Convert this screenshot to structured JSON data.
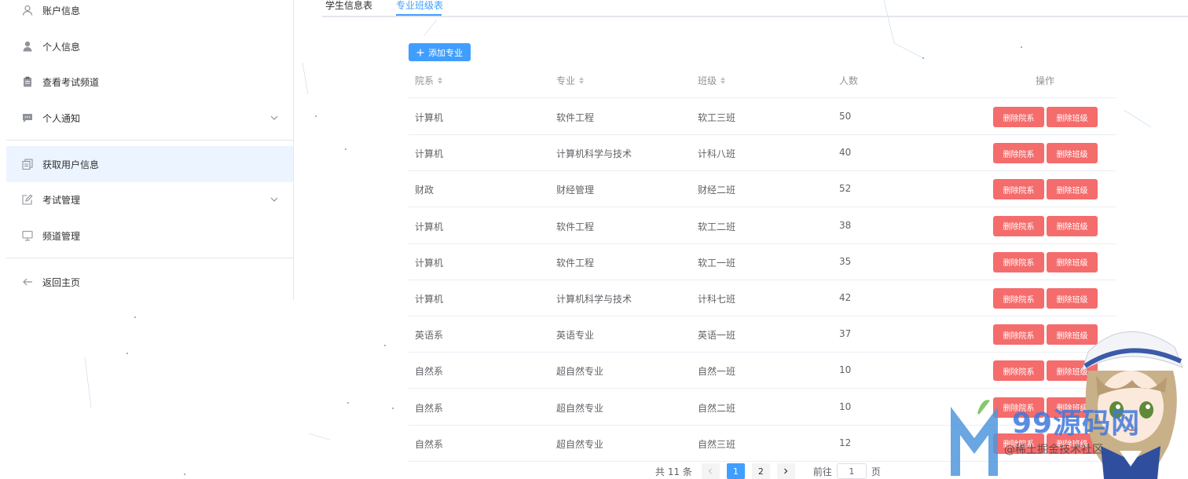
{
  "sidebar": {
    "items": [
      {
        "label": "账户信息",
        "icon": "user-outline-icon"
      },
      {
        "label": "个人信息",
        "icon": "user-solid-icon"
      },
      {
        "label": "查看考试频道",
        "icon": "clipboard-icon"
      },
      {
        "label": "个人通知",
        "icon": "chat-icon",
        "expandable": true
      },
      {
        "label": "获取用户信息",
        "icon": "document-copy-icon",
        "active": true
      },
      {
        "label": "考试管理",
        "icon": "edit-icon",
        "expandable": true
      },
      {
        "label": "频道管理",
        "icon": "monitor-icon"
      },
      {
        "label": "返回主页",
        "icon": "back-arrow-icon"
      }
    ]
  },
  "tabs": [
    {
      "label": "学生信息表",
      "active": false
    },
    {
      "label": "专业班级表",
      "active": true
    }
  ],
  "toolbar": {
    "add_label": "添加专业"
  },
  "table": {
    "columns": [
      "院系",
      "专业",
      "班级",
      "人数",
      "操作"
    ],
    "rows": [
      {
        "dept": "计算机",
        "major": "软件工程",
        "class": "软工三班",
        "count": "50"
      },
      {
        "dept": "计算机",
        "major": "计算机科学与技术",
        "class": "计科八班",
        "count": "40"
      },
      {
        "dept": "财政",
        "major": "财经管理",
        "class": "财经二班",
        "count": "52"
      },
      {
        "dept": "计算机",
        "major": "软件工程",
        "class": "软工二班",
        "count": "38"
      },
      {
        "dept": "计算机",
        "major": "软件工程",
        "class": "软工一班",
        "count": "35"
      },
      {
        "dept": "计算机",
        "major": "计算机科学与技术",
        "class": "计科七班",
        "count": "42"
      },
      {
        "dept": "英语系",
        "major": "英语专业",
        "class": "英语一班",
        "count": "37"
      },
      {
        "dept": "自然系",
        "major": "超自然专业",
        "class": "自然一班",
        "count": "10"
      },
      {
        "dept": "自然系",
        "major": "超自然专业",
        "class": "自然二班",
        "count": "10"
      },
      {
        "dept": "自然系",
        "major": "超自然专业",
        "class": "自然三班",
        "count": "12"
      }
    ],
    "delete_dept_label": "删除院系",
    "delete_class_label": "删除班级"
  },
  "pagination": {
    "total": "共 11 条",
    "pages": [
      "1",
      "2"
    ],
    "current": "1",
    "goto_label": "前往",
    "goto_value": "1",
    "page_suffix": "页"
  },
  "watermark": {
    "brand": "99源码网",
    "sub": "@稀土掘金技术社区"
  },
  "colors": {
    "primary": "#409eff",
    "danger": "#f56c6c",
    "active_bg": "#ecf5ff"
  }
}
